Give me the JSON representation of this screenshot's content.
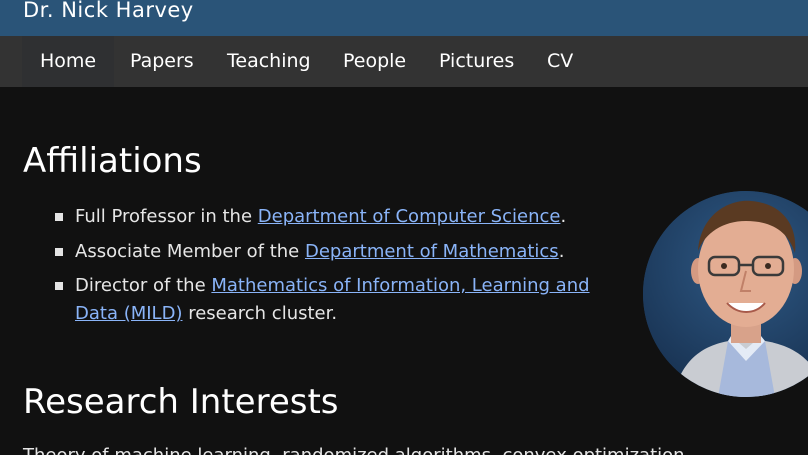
{
  "header": {
    "title": "Dr. Nick Harvey"
  },
  "nav": {
    "items": [
      {
        "label": "Home"
      },
      {
        "label": "Papers"
      },
      {
        "label": "Teaching"
      },
      {
        "label": "People"
      },
      {
        "label": "Pictures"
      },
      {
        "label": "CV"
      }
    ]
  },
  "affiliations": {
    "heading": "Affiliations",
    "items": [
      {
        "pre": "Full Professor in the ",
        "link": "Department of Computer Science",
        "post": "."
      },
      {
        "pre": "Associate Member of the ",
        "link": "Department of Mathematics",
        "post": "."
      },
      {
        "pre": "Director of the ",
        "link_line1": "Mathematics of Information, Learning and",
        "link_line2": "Data (MILD)",
        "post": " research cluster."
      }
    ]
  },
  "research": {
    "heading": "Research Interests",
    "text": "Theory of machine learning, randomized algorithms, convex optimization"
  },
  "colors": {
    "header_bg": "#2a5478",
    "nav_bg": "#333333",
    "page_bg": "#111111",
    "link": "#8ab4f8"
  }
}
